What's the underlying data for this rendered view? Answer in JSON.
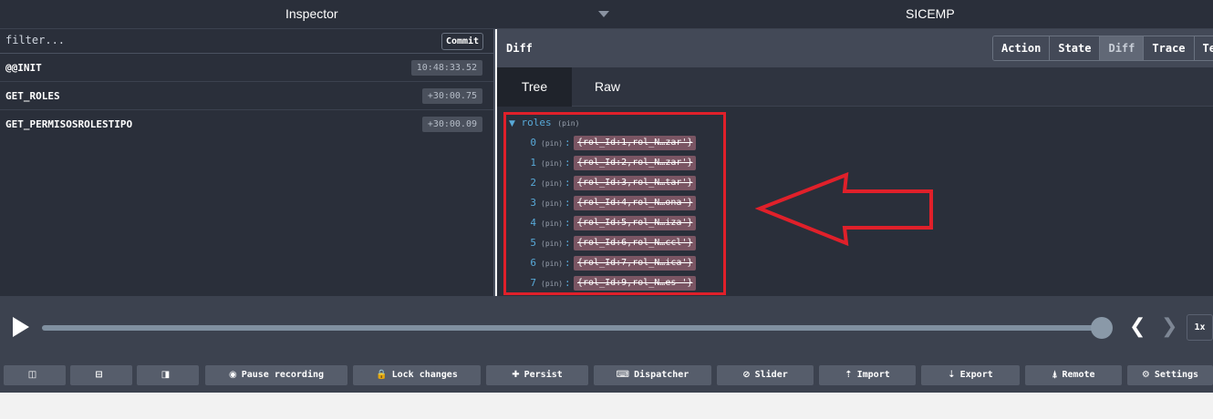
{
  "topbar": {
    "left_title": "Inspector",
    "right_title": "SICEMP"
  },
  "left": {
    "filter_placeholder": "filter...",
    "commit_label": "Commit",
    "actions": [
      {
        "name": "@@INIT",
        "time": "10:48:33.52"
      },
      {
        "name": "GET_ROLES",
        "time": "+30:00.75"
      },
      {
        "name": "GET_PERMISOSROLESTIPO",
        "time": "+30:00.09"
      }
    ]
  },
  "right": {
    "title": "Diff",
    "modes": [
      "Action",
      "State",
      "Diff",
      "Trace",
      "Tes"
    ],
    "active_mode": "Diff",
    "tabs": [
      "Tree",
      "Raw"
    ],
    "active_tab": "Tree",
    "tree": {
      "root_key": "roles",
      "pin_label": "(pin)",
      "items": [
        {
          "key": "0",
          "value": "{rol_Id:1,rol_N…zar'}"
        },
        {
          "key": "1",
          "value": "{rol_Id:2,rol_N…zar'}"
        },
        {
          "key": "2",
          "value": "{rol_Id:3,rol_N…tar'}"
        },
        {
          "key": "3",
          "value": "{rol_Id:4,rol_N…ona'}"
        },
        {
          "key": "4",
          "value": "{rol_Id:5,rol_N…iza'}"
        },
        {
          "key": "5",
          "value": "{rol_Id:6,rol_N…ccl'}"
        },
        {
          "key": "6",
          "value": "{rol_Id:7,rol_N…ica'}"
        },
        {
          "key": "7",
          "value": "{rol_Id:9,rol_N…es '}"
        }
      ]
    }
  },
  "slider": {
    "speed": "1x"
  },
  "buttons": [
    {
      "label": "",
      "icon": "layout-icon"
    },
    {
      "label": "",
      "icon": "layout-icon"
    },
    {
      "label": "",
      "icon": "layout-icon"
    },
    {
      "label": "Pause recording",
      "icon": "record-icon"
    },
    {
      "label": "Lock changes",
      "icon": "lock-icon"
    },
    {
      "label": "Persist",
      "icon": "pin-icon"
    },
    {
      "label": "Dispatcher",
      "icon": "keyboard-icon"
    },
    {
      "label": "Slider",
      "icon": "clock-icon"
    },
    {
      "label": "Import",
      "icon": "upload-icon"
    },
    {
      "label": "Export",
      "icon": "download-icon"
    },
    {
      "label": "Remote",
      "icon": "antenna-icon"
    },
    {
      "label": "Settings",
      "icon": "gear-icon"
    }
  ],
  "colors": {
    "annotation": "#e0202a",
    "background": "#2a2f3a",
    "value_badge": "#7a5563"
  }
}
